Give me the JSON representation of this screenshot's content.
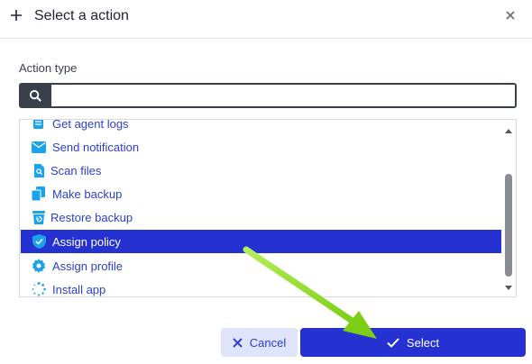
{
  "dialog": {
    "title": "Select a action",
    "icons": {
      "add": "plus-icon",
      "close": "close-icon"
    }
  },
  "form": {
    "label": "Action type",
    "search": {
      "value": "",
      "placeholder": "",
      "icon": "search-icon"
    }
  },
  "actions": {
    "items": [
      {
        "label": "Get agent logs",
        "icon": "log-icon",
        "selected": false
      },
      {
        "label": "Send notification",
        "icon": "envelope-icon",
        "selected": false
      },
      {
        "label": "Scan files",
        "icon": "file-search-icon",
        "selected": false
      },
      {
        "label": "Make backup",
        "icon": "copy-icon",
        "selected": false
      },
      {
        "label": "Restore backup",
        "icon": "restore-icon",
        "selected": false
      },
      {
        "label": "Assign policy",
        "icon": "shield-check-icon",
        "selected": true
      },
      {
        "label": "Assign profile",
        "icon": "gear-icon",
        "selected": false
      },
      {
        "label": "Install app",
        "icon": "spinner-icon",
        "selected": false
      }
    ]
  },
  "buttons": {
    "cancel": "Cancel",
    "select": "Select"
  },
  "colors": {
    "accent": "#2631d2",
    "link": "#2b3fd1",
    "icon": "#1aa3e8",
    "annotation_arrow": "#8ad81f"
  }
}
